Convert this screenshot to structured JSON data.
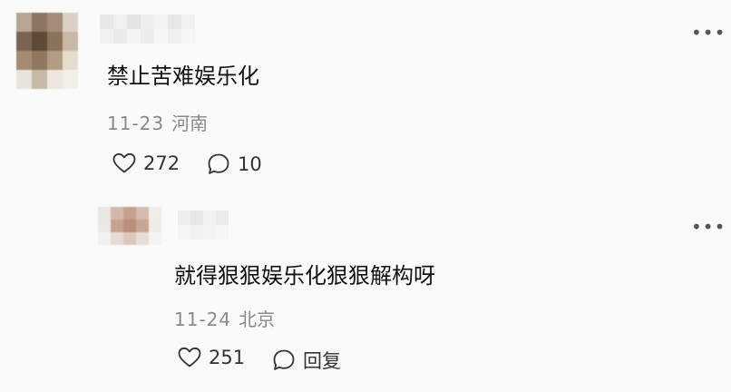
{
  "comments": [
    {
      "text": "禁止苦难娱乐化",
      "date": "11-23",
      "location": "河南",
      "likes": "272",
      "replies": "10",
      "reply_is_count": true,
      "more_icon": "ellipsis-icon"
    },
    {
      "text": "就得狠狠娱乐化狠狠解构呀",
      "date": "11-24",
      "location": "北京",
      "likes": "251",
      "replies": "回复",
      "reply_is_count": false,
      "more_icon": "ellipsis-icon"
    }
  ],
  "icons": {
    "like": "heart-outline-icon",
    "reply": "speech-bubble-icon",
    "more": "ellipsis-icon"
  },
  "colors": {
    "background": "#fafafa",
    "text": "#111111",
    "meta": "#8a8a8a",
    "icon": "#333333"
  }
}
